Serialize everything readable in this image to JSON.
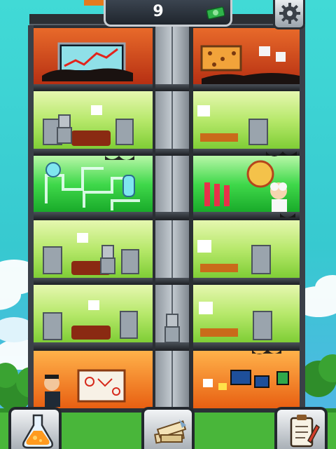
{
  "hud": {
    "cash_count": "9",
    "cash_icon": "cash-bundle-icon",
    "settings_icon": "gear-icon"
  },
  "bottom_bar": {
    "buttons": [
      {
        "icon": "potion-flask-icon"
      },
      {
        "icon": "cash-stack-icon"
      },
      {
        "icon": "clipboard-quest-icon"
      }
    ]
  },
  "tower": {
    "floors": [
      {
        "name": "executive-office",
        "color": "#d9521f",
        "rooms": [
          "stock-chart-room",
          "planning-board-room"
        ]
      },
      {
        "name": "lounge",
        "color": "#b6e86a",
        "rooms": [
          "lounge-room-left",
          "lounge-room-right"
        ]
      },
      {
        "name": "laboratory",
        "color": "#3fd84a",
        "rooms": [
          "chemistry-lab-left",
          "chemistry-lab-right"
        ]
      },
      {
        "name": "lounge",
        "color": "#b6e86a",
        "rooms": [
          "lounge-room-left",
          "lounge-room-right"
        ]
      },
      {
        "name": "lounge",
        "color": "#b6e86a",
        "rooms": [
          "lounge-room-left",
          "lounge-room-right"
        ]
      },
      {
        "name": "design-office",
        "color": "#f0751c",
        "rooms": [
          "art-office-left",
          "art-office-right"
        ]
      }
    ]
  }
}
